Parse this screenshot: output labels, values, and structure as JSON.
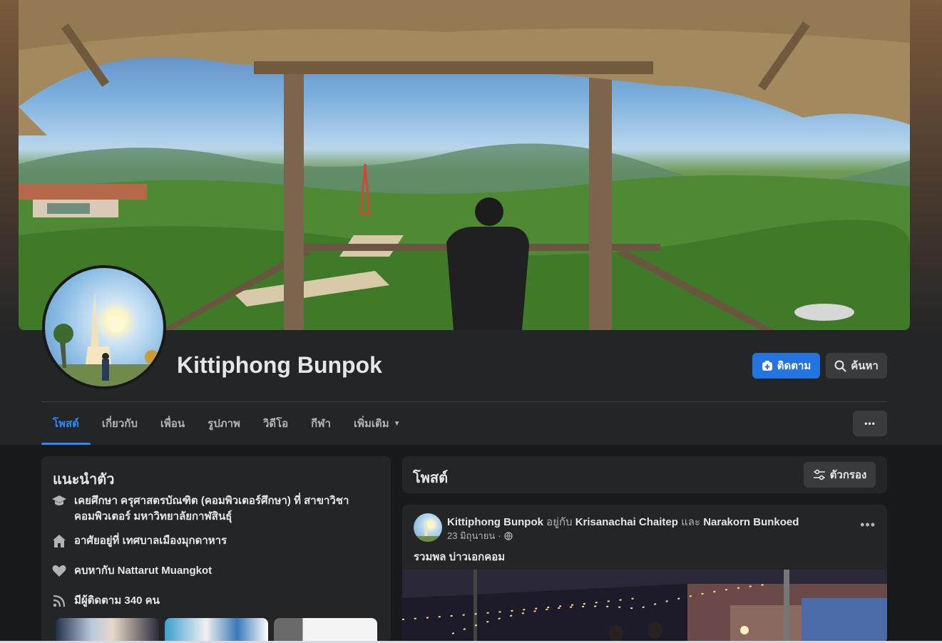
{
  "profile": {
    "name": "Kittiphong Bunpok"
  },
  "actions": {
    "follow_label": "ติดตาม",
    "search_label": "ค้นหา",
    "more_label": "•••"
  },
  "tabs": [
    {
      "label": "โพสต์",
      "active": true
    },
    {
      "label": "เกี่ยวกับ"
    },
    {
      "label": "เพื่อน"
    },
    {
      "label": "รูปภาพ"
    },
    {
      "label": "วิดีโอ"
    },
    {
      "label": "กีฬา"
    },
    {
      "label": "เพิ่มเติม"
    }
  ],
  "intro": {
    "title": "แนะนำตัว",
    "items": [
      {
        "icon": "graduation-cap-icon",
        "text": "เคยศึกษา ครุศาสตรบัณฑิต (คอมพิวเตอร์ศึกษา) ที่ สาขาวิชาคอมพิวเตอร์ มหาวิทยาลัยกาฬสินธุ์"
      },
      {
        "icon": "home-icon",
        "text": "อาศัยอยู่ที่ เทศบาลเมืองมุกดาหาร"
      },
      {
        "icon": "heart-icon",
        "text": "คบหากับ Nattarut Muangkot"
      },
      {
        "icon": "rss-icon",
        "text": "มีผู้ติดตาม 340 คน"
      }
    ]
  },
  "posts_header": {
    "title": "โพสต์",
    "filter_label": "ตัวกรอง"
  },
  "post": {
    "author": "Kittiphong Bunpok",
    "with_word": "อยู่กับ",
    "tag1": "Krisanachai Chaitep",
    "and_word": "และ",
    "tag2": "Narakorn Bunkoed",
    "date": "23 มิถุนายน",
    "separator": "·",
    "privacy_icon": "globe-icon",
    "text": "รวมพล บ่าวเอกคอม",
    "more_label": "•••"
  },
  "colors": {
    "accent": "#2374e1",
    "active_tab": "#2d88ff",
    "card_bg": "#242526",
    "page_bg": "#18191a"
  }
}
